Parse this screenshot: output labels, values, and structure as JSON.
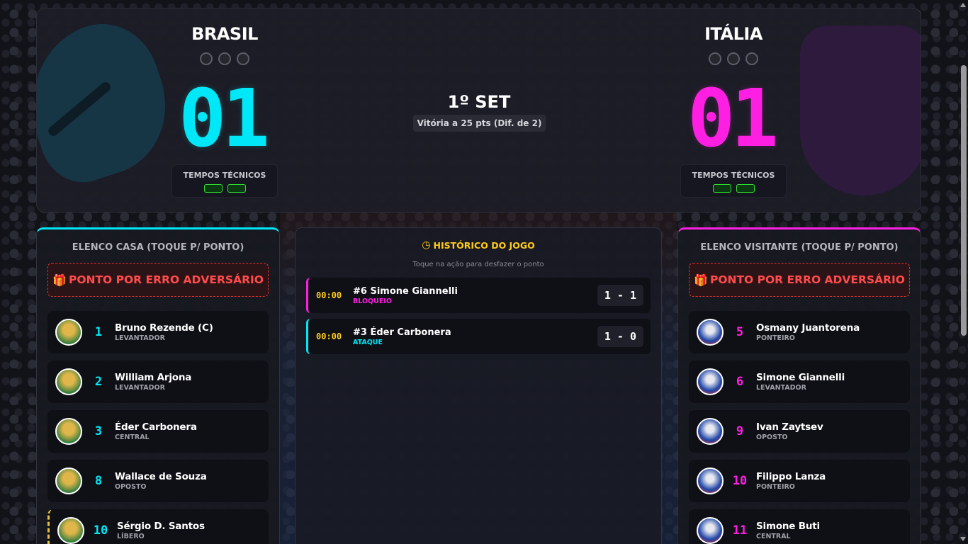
{
  "home": {
    "name": "BRASIL",
    "score": "01",
    "timeouts_label": "TEMPOS TÉCNICOS",
    "panel_title": "ELENCO CASA (TOQUE P/ PONTO)",
    "error_button": "PONTO POR ERRO ADVERSÁRIO",
    "players": [
      {
        "number": "1",
        "name": "Bruno Rezende (C)",
        "position": "LEVANTADOR"
      },
      {
        "number": "2",
        "name": "William Arjona",
        "position": "LEVANTADOR"
      },
      {
        "number": "3",
        "name": "Éder Carbonera",
        "position": "CENTRAL"
      },
      {
        "number": "8",
        "name": "Wallace de Souza",
        "position": "OPOSTO"
      },
      {
        "number": "10",
        "name": "Sérgio D. Santos",
        "position": "LÍBERO"
      }
    ]
  },
  "away": {
    "name": "ITÁLIA",
    "score": "01",
    "timeouts_label": "TEMPOS TÉCNICOS",
    "panel_title": "ELENCO VISITANTE (TOQUE P/ PONTO)",
    "error_button": "PONTO POR ERRO ADVERSÁRIO",
    "players": [
      {
        "number": "5",
        "name": "Osmany Juantorena",
        "position": "PONTEIRO"
      },
      {
        "number": "6",
        "name": "Simone Giannelli",
        "position": "LEVANTADOR"
      },
      {
        "number": "9",
        "name": "Ivan Zaytsev",
        "position": "OPOSTO"
      },
      {
        "number": "10",
        "name": "Filippo Lanza",
        "position": "PONTEIRO"
      },
      {
        "number": "11",
        "name": "Simone Buti",
        "position": "CENTRAL"
      }
    ]
  },
  "set": {
    "title": "1º SET",
    "rule": "Vitória a 25 pts (Dif. de 2)"
  },
  "history": {
    "title": "HISTÓRICO DO JOGO",
    "hint": "Toque na ação para desfazer o ponto",
    "events": [
      {
        "time": "00:00",
        "player": "#6 Simone Giannelli",
        "action": "BLOQUEIO",
        "score": "1 - 1",
        "team": "away"
      },
      {
        "time": "00:00",
        "player": "#3 Éder Carbonera",
        "action": "ATAQUE",
        "score": "1 - 0",
        "team": "home"
      }
    ]
  },
  "colors": {
    "home_accent": "#00e7f7",
    "away_accent": "#ff1fe3",
    "history_accent": "#ffcc1a",
    "error_red": "#ff4b4b",
    "timeout_green": "#32e032"
  },
  "icons": {
    "error_button": "gift-icon",
    "history": "history-icon"
  }
}
